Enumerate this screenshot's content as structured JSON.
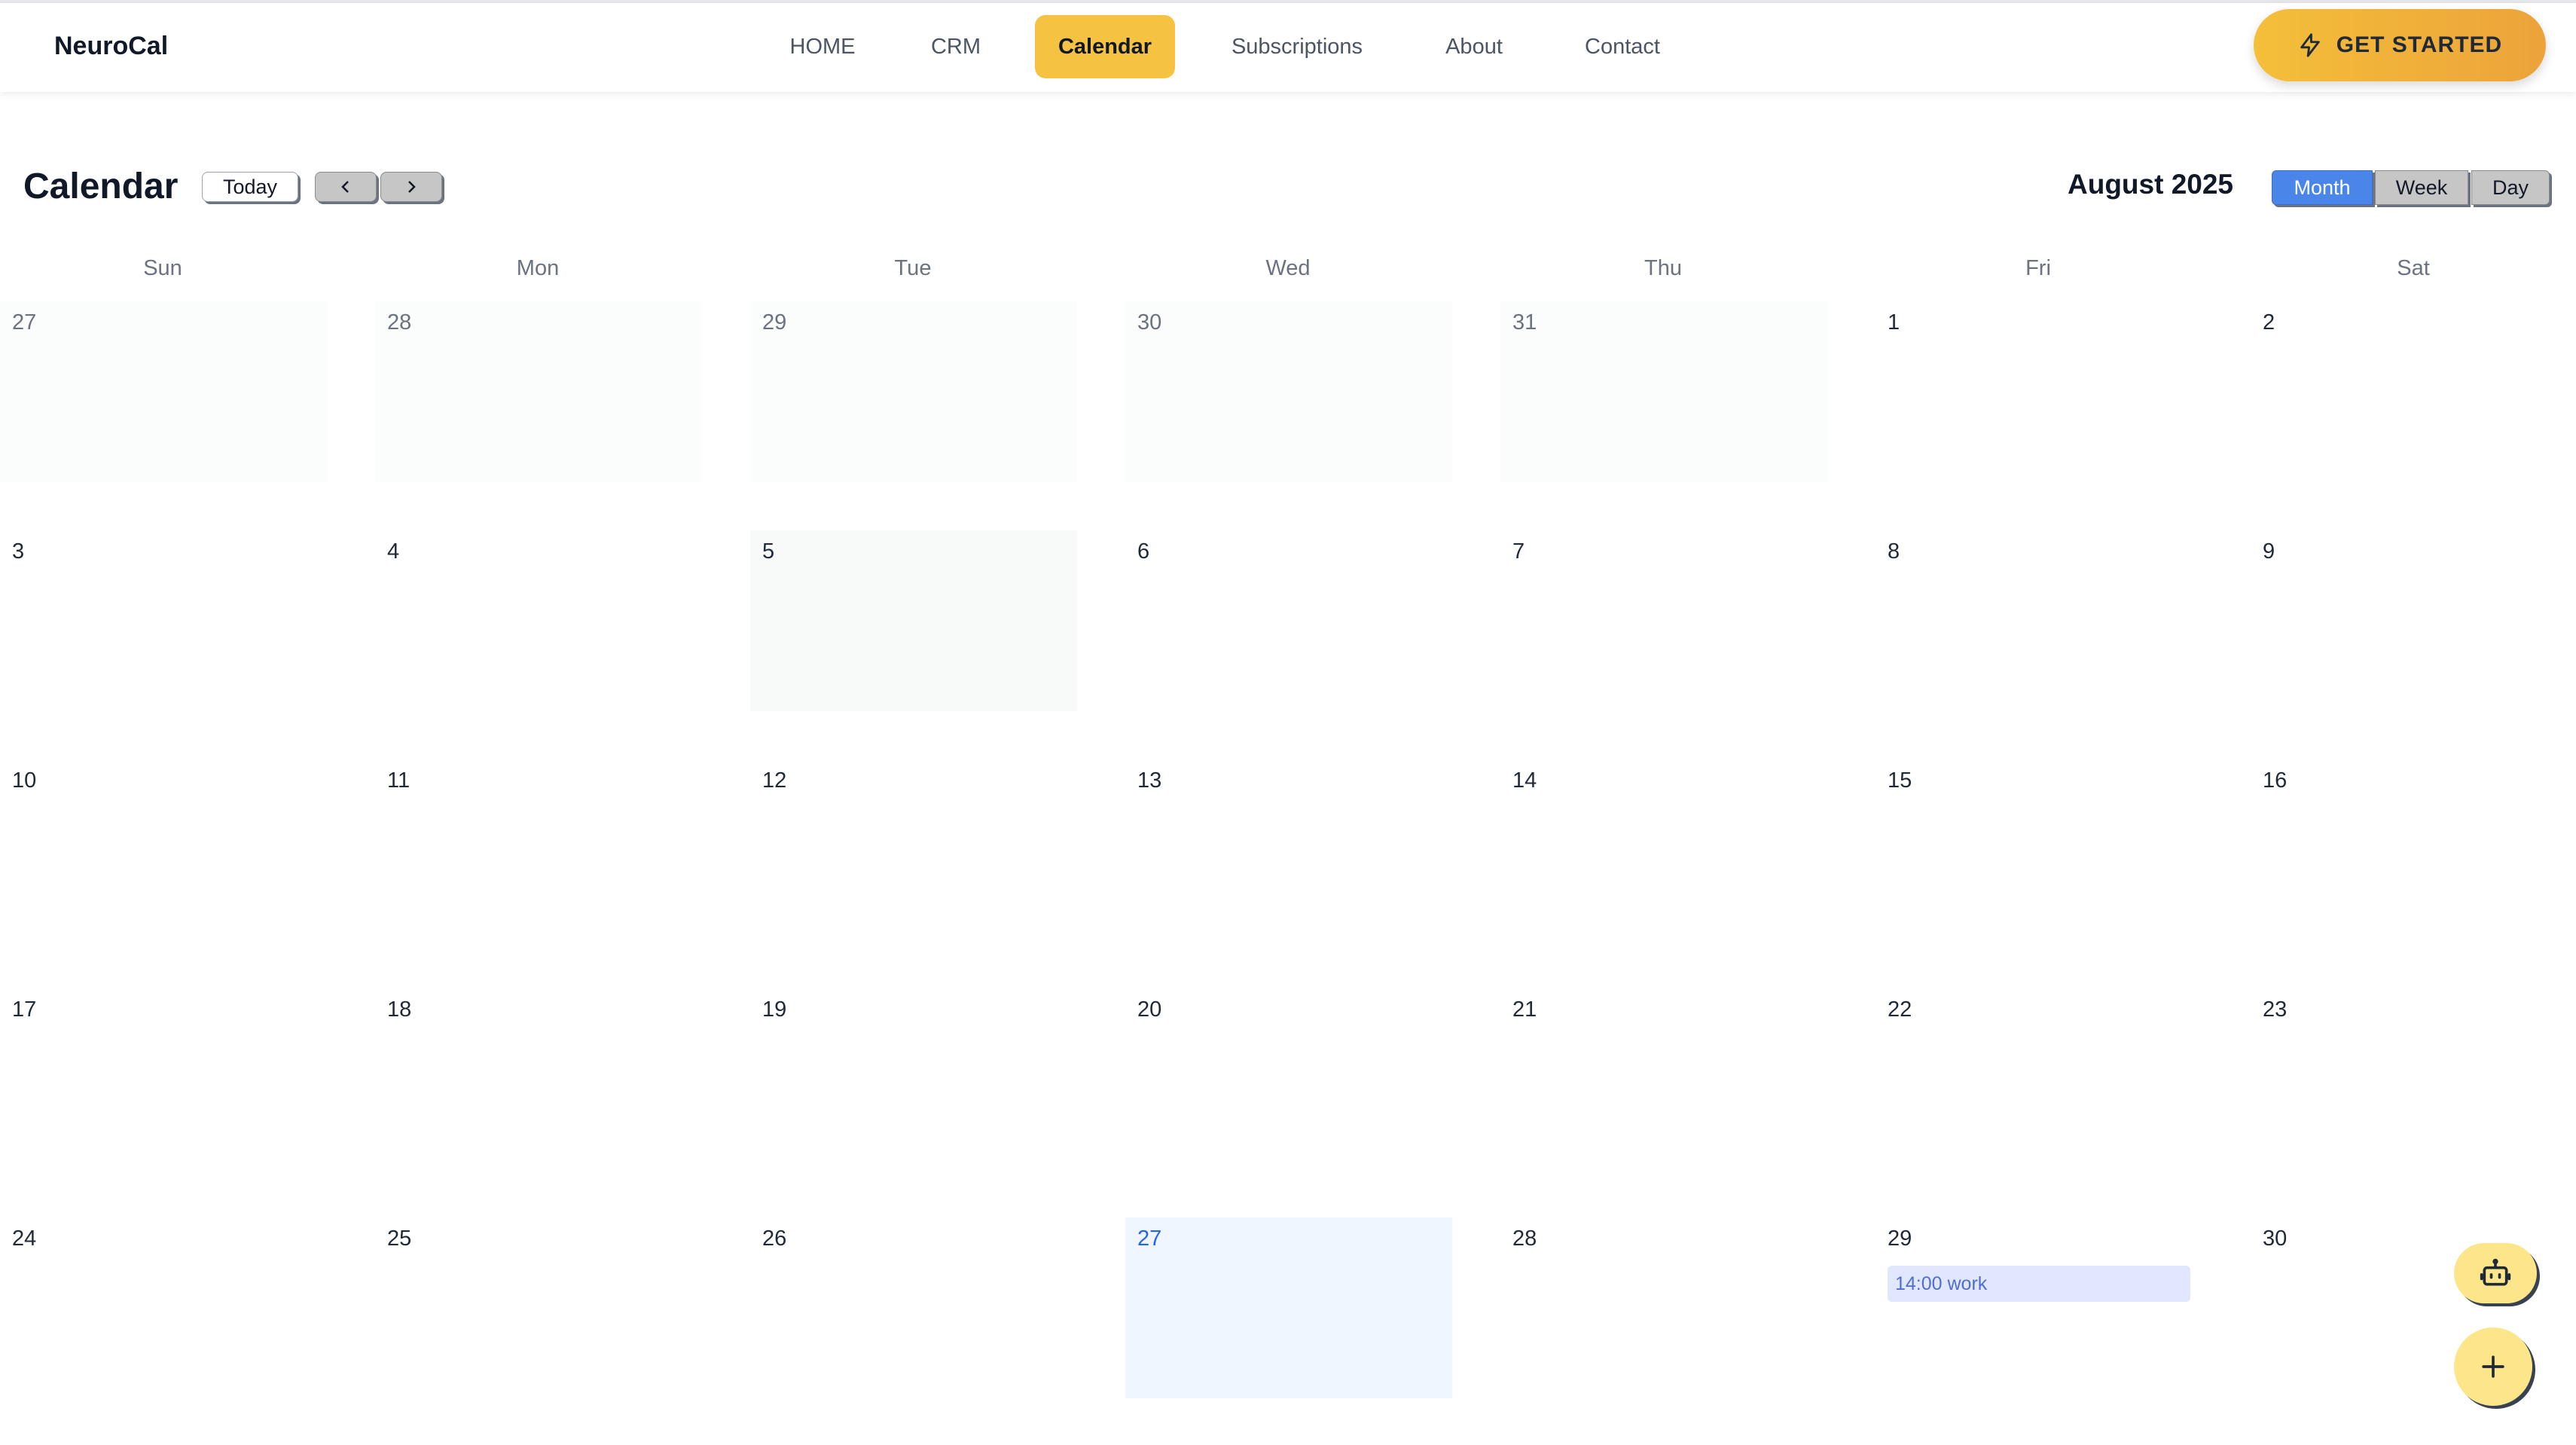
{
  "app": {
    "name": "NeuroCal"
  },
  "nav": {
    "items": [
      {
        "label": "HOME"
      },
      {
        "label": "CRM"
      },
      {
        "label": "Calendar"
      },
      {
        "label": "Subscriptions"
      },
      {
        "label": "About"
      },
      {
        "label": "Contact"
      }
    ],
    "active_item": "Calendar",
    "cta_label": "GET STARTED",
    "cta_icon": "lightning-icon"
  },
  "calendar": {
    "title": "Calendar",
    "today_label": "Today",
    "prev_icon": "chevron-left-icon",
    "next_icon": "chevron-right-icon",
    "month_label": "August 2025",
    "views": [
      {
        "label": "Month"
      },
      {
        "label": "Week"
      },
      {
        "label": "Day"
      }
    ],
    "active_view": "Month",
    "weekdays": [
      "Sun",
      "Mon",
      "Tue",
      "Wed",
      "Thu",
      "Fri",
      "Sat"
    ],
    "weeks": [
      [
        "27",
        "28",
        "29",
        "30",
        "31",
        "1",
        "2"
      ],
      [
        "3",
        "4",
        "5",
        "6",
        "7",
        "8",
        "9"
      ],
      [
        "10",
        "11",
        "12",
        "13",
        "14",
        "15",
        "16"
      ],
      [
        "17",
        "18",
        "19",
        "20",
        "21",
        "22",
        "23"
      ],
      [
        "24",
        "25",
        "26",
        "27",
        "28",
        "29",
        "30"
      ]
    ],
    "events": [
      {
        "date": "29",
        "label": "14:00 work"
      }
    ]
  },
  "fabs": {
    "assistant_icon": "robot-icon",
    "add_icon": "plus-icon"
  },
  "colors": {
    "accent": "#f6c242",
    "primary": "#4a86ea",
    "today_bg": "#eff6ff",
    "event_bg": "#e0e7ff",
    "event_text": "#4f6ecf"
  }
}
